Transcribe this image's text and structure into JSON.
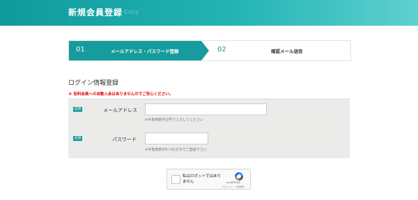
{
  "header": {
    "title": "新規会員登録",
    "subtitle": "Entry"
  },
  "steps": [
    {
      "num": "01",
      "label": "メールアドレス・パスワード登録",
      "active": true
    },
    {
      "num": "02",
      "label": "確認メール送信",
      "active": false
    }
  ],
  "section_title": "ログイン情報登録",
  "notice": "＊ 有料会員への自動入会はありませんのでご安心ください。",
  "form": {
    "required_badge": "必須",
    "email": {
      "label": "メールアドレス",
      "value": "",
      "note": "※半角英数字記号で入力してください"
    },
    "password": {
      "label": "パスワード",
      "value": "",
      "note": "※半角英数字6〜32文字でご登録下さい"
    }
  },
  "recaptcha": {
    "label": "私はロボットではありません",
    "brand": "reCAPTCHA",
    "terms": "プライバシー - 利用規約"
  },
  "colors": {
    "accent": "#169c9c",
    "notice": "#e60000"
  }
}
